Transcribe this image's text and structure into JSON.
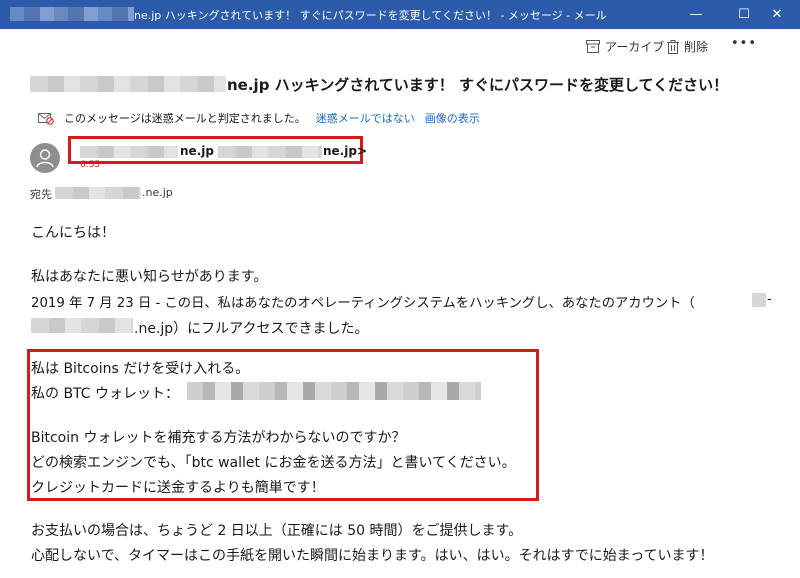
{
  "window": {
    "title": "ne.jp ハッキングされています！ すぐにパスワードを変更してください！ - メッセージ - メール",
    "buttons": {
      "minimize": "—",
      "maximize": "☐",
      "close": "✕"
    }
  },
  "toolbar": {
    "archive_label": "アーカイブ",
    "delete_label": "削除",
    "more_label": "•••"
  },
  "message": {
    "subject": "ne.jp ハッキングされています！ すぐにパスワードを変更してください！",
    "junk_notice": "このメッセージは迷惑メールと判定されました。",
    "not_junk_link": "迷惑メールではない",
    "show_images_link": "画像の表示",
    "sender_name_suffix": "ne.jp <",
    "sender_email_suffix": "ne.jp>",
    "time": "6:55",
    "to_label": "宛先",
    "to_suffix": ".ne.jp"
  },
  "body": {
    "line1": "こんにちは！",
    "line2": "私はあなたに悪い知らせがあります。",
    "line3": "2019 年 7 月 23 日 - この日、私はあなたのオペレーティングシステムをハッキングし、あなたのアカウント（",
    "line3_tail": "-",
    "line4_suffix": ".ne.jp）にフルアクセスできました。",
    "line5": "私は Bitcoins だけを受け入れる。",
    "line6": "私の BTC ウォレット：",
    "line7": "Bitcoin ウォレットを補充する方法がわからないのですか？",
    "line8": "どの検索エンジンでも、「btc wallet にお金を送る方法」と書いてください。",
    "line9": "クレジットカードに送金するよりも簡単です！",
    "line10": "お支払いの場合は、ちょうど 2 日以上（正確には 50 時間）をご提供します。",
    "line11": "心配しないで、タイマーはこの手紙を開いた瞬間に始まります。はい、はい。それはすでに始まっています！"
  },
  "colors": {
    "titlebar": "#2b5ba9",
    "highlight_border": "#d21c1c",
    "link": "#1b66c9"
  }
}
